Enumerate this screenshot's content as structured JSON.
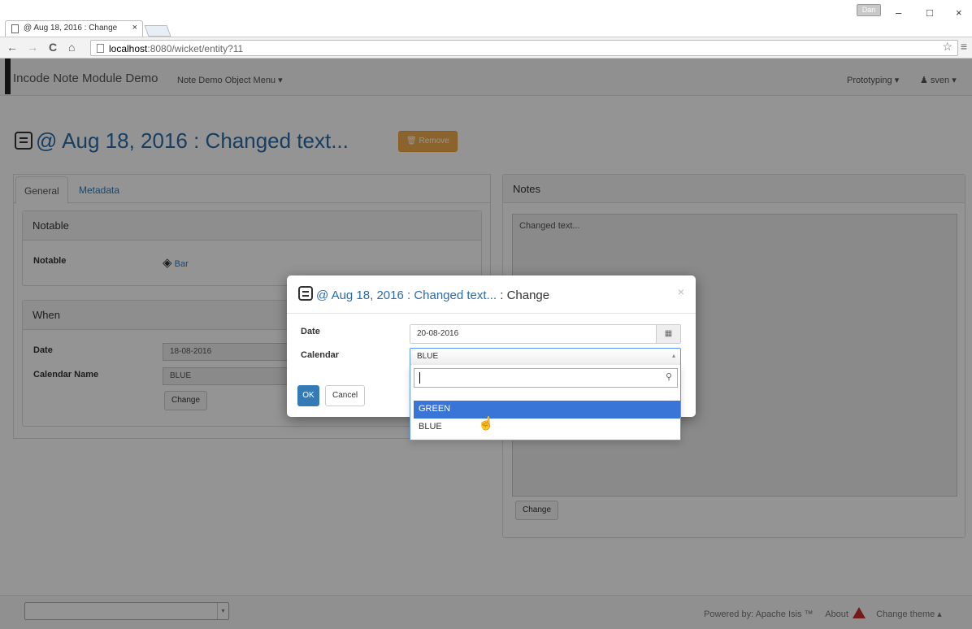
{
  "browser": {
    "tab_title": "@ Aug 18, 2016 : Change",
    "tab_close": "×",
    "user_chip": "Dan",
    "win_min": "–",
    "win_max": "□",
    "win_close": "×",
    "url_host": "localhost",
    "url_rest": ":8080/wicket/entity?11",
    "star": "☆",
    "menu": "≡",
    "nav_back": "←",
    "nav_forward": "→",
    "nav_reload": "C",
    "nav_home": "⌂"
  },
  "app": {
    "brand": "Incode Note Module Demo",
    "menu": "Note Demo Object Menu ▾",
    "prototyping": "Prototyping ▾",
    "user": "sven ▾",
    "page_title": "@ Aug 18, 2016 : Changed text...",
    "remove": "🗑 Remove",
    "tabs": {
      "general": "General",
      "metadata": "Metadata"
    },
    "notable_panel": {
      "heading": "Notable",
      "label": "Notable",
      "value": "Bar",
      "icon": "◈"
    },
    "when_panel": {
      "heading": "When",
      "date_label": "Date",
      "date_value": "18-08-2016",
      "calendar_label": "Calendar Name",
      "calendar_value": "BLUE",
      "change": "Change"
    },
    "notes_panel": {
      "heading": "Notes",
      "text": "Changed text...",
      "change": "Change"
    },
    "footer": {
      "powered": "Powered by: Apache Isis ™",
      "about": "About",
      "change_theme": "Change theme ▴",
      "caret": "▾"
    }
  },
  "modal": {
    "title_link": "@ Aug 18, 2016 : Changed text...",
    "title_suffix": " : Change",
    "close": "×",
    "date_label": "Date",
    "date_value": "20-08-2016",
    "calendar_icon": "▦",
    "calendar_label": "Calendar",
    "calendar_value": "BLUE",
    "calendar_caret": "▴",
    "ok": "OK",
    "cancel": "Cancel",
    "search_icon": "⚲",
    "options": [
      "GREEN",
      "BLUE"
    ]
  },
  "colors": {
    "link": "#2a6ba8",
    "primary": "#337ab7",
    "warning": "#f0ad4e",
    "highlight": "#3875d7"
  }
}
